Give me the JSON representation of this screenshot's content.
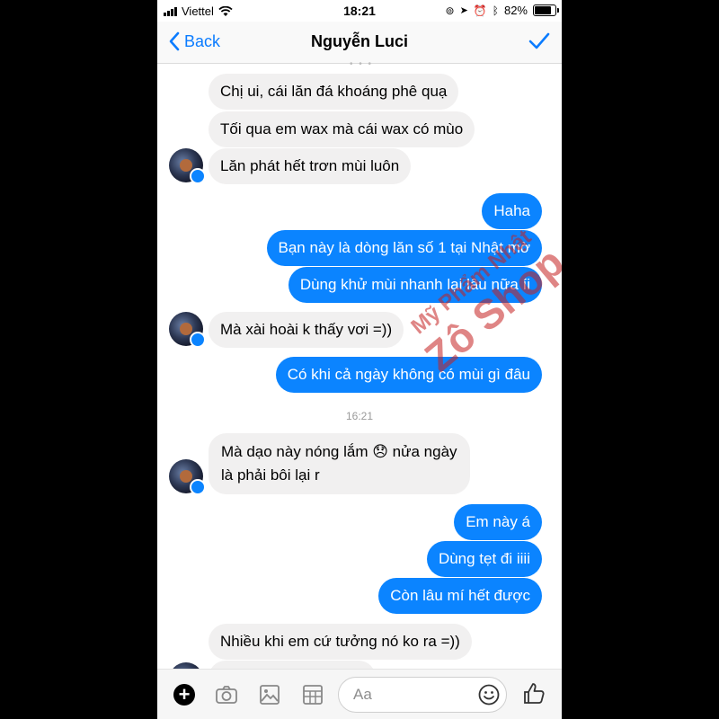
{
  "status_bar": {
    "carrier": "Viettel",
    "time": "18:21",
    "battery": "82%"
  },
  "nav": {
    "back_label": "Back",
    "title": "Nguyễn Luci"
  },
  "messages": [
    {
      "text": "Chị ui, cái lăn đá khoáng phê quạ"
    },
    {
      "text": "Tối qua em wax mà cái wax có mùo"
    },
    {
      "text": "Lăn phát hết trơn mùi luôn"
    },
    {
      "text": "Haha"
    },
    {
      "text": "Bạn này là dòng lăn số 1 tại Nhật mờ"
    },
    {
      "text": "Dùng khử mùi nhanh lại lâu nữa íi"
    },
    {
      "text": "Mà xài hoài k thấy vơi =))"
    },
    {
      "text": "Có khi cả ngày không có mùi gì đâu"
    },
    {
      "line1": "Mà dạo này nóng lắm 😞 nửa ngày",
      "line2": "là phải bôi lại r"
    },
    {
      "text": "Em này á"
    },
    {
      "text": "Dùng tẹt đi iiii"
    },
    {
      "text": "Còn lâu mí hết được"
    },
    {
      "text": "Nhiều khi em cứ tưởng nó ko ra =))"
    }
  ],
  "timestamp": "16:21",
  "watermark": {
    "line1": "Mỹ Phẩm Nhật",
    "line2": "Zô Shop"
  },
  "composer": {
    "placeholder": "Aa"
  },
  "icons": [
    "signal-icon",
    "wifi-icon",
    "battery-icon",
    "back-chevron-icon",
    "checkmark-icon",
    "plus-icon",
    "camera-icon",
    "image-icon",
    "grid-icon",
    "emoji-icon",
    "like-icon"
  ],
  "colors": {
    "accent": "#0b84ff",
    "incoming_bubble": "#f1f0f0",
    "watermark": "#c42020"
  }
}
